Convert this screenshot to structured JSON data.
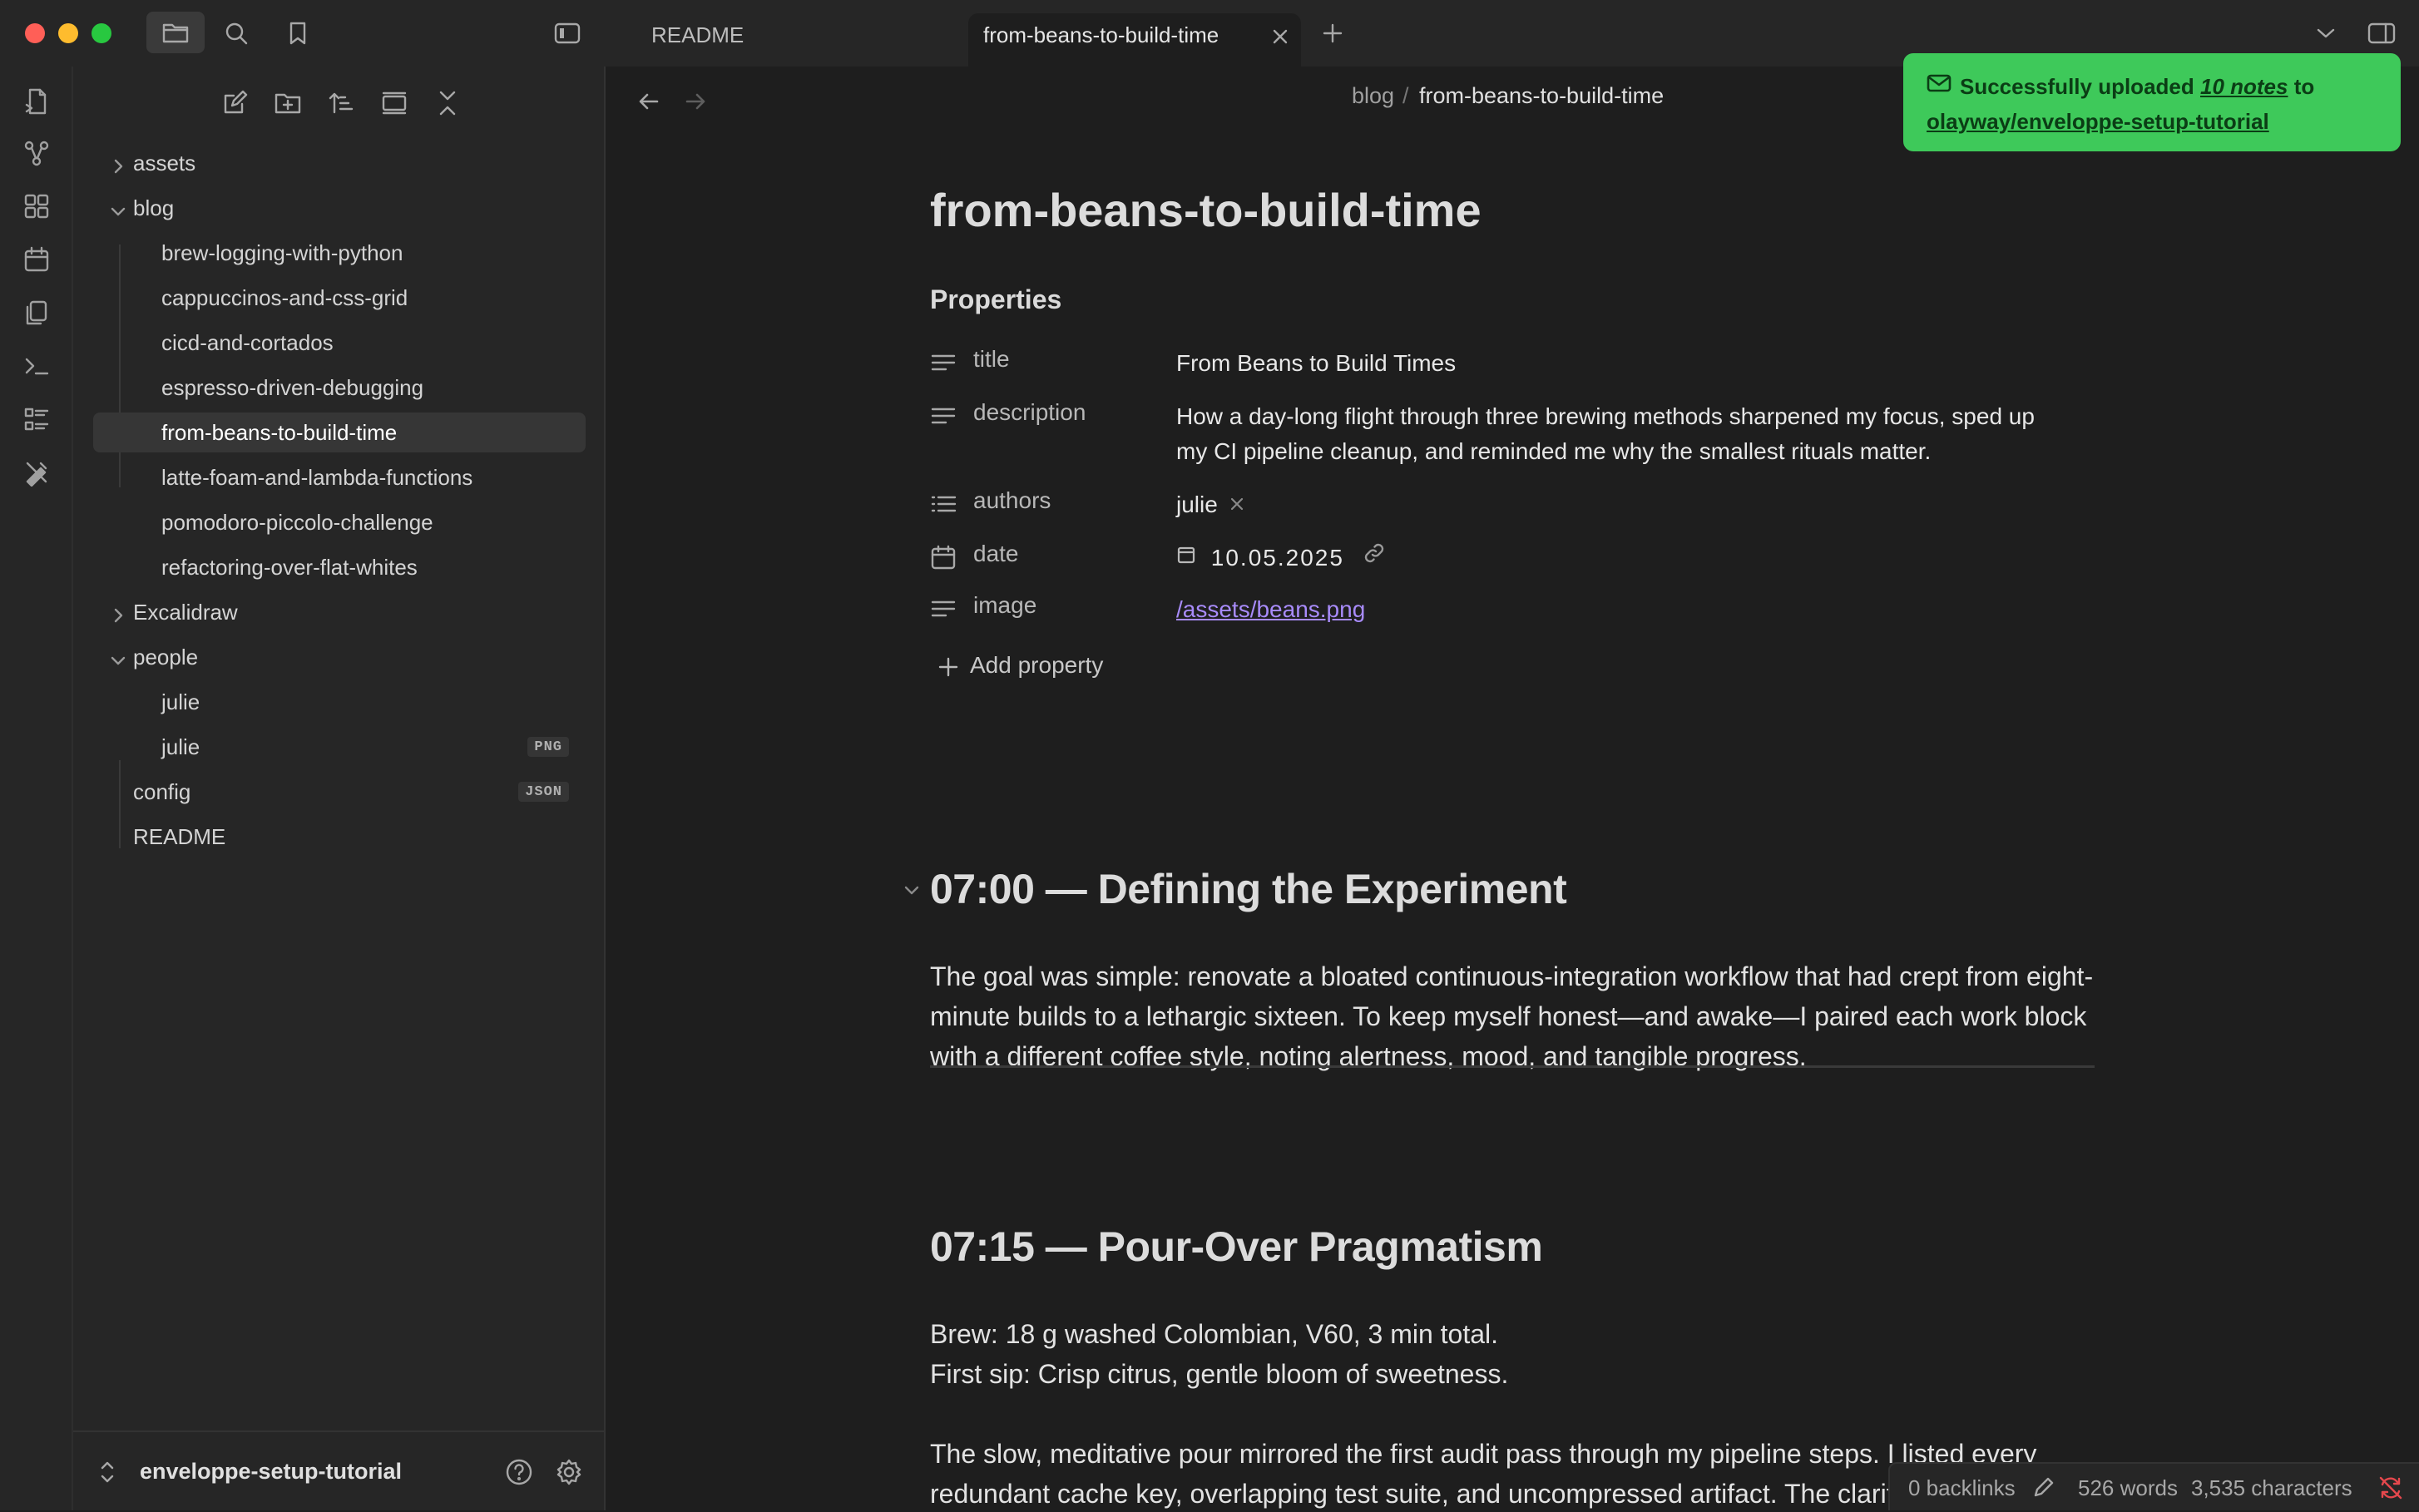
{
  "window": {
    "traffic_lights": {
      "close": "#ff5f57",
      "minimize": "#febc2e",
      "maximize": "#28c840"
    }
  },
  "tabs": [
    {
      "label": "README",
      "active": false
    },
    {
      "label": "from-beans-to-build-time",
      "active": true
    }
  ],
  "icons": {
    "toolbar": [
      "folder-icon",
      "search-icon",
      "bookmark-icon",
      "sidebar-toggle-icon",
      "new-tab-icon",
      "tab-list-chevron-icon",
      "right-sidebar-icon"
    ],
    "ribbon": [
      "open-quick-switcher-icon",
      "graph-view-icon",
      "canvas-icon",
      "daily-note-calendar-icon",
      "templates-icon",
      "command-palette-icon",
      "kanban-icon",
      "excalidraw-icon"
    ],
    "sidebar_tools": [
      "new-note-icon",
      "new-folder-icon",
      "sort-icon",
      "collapse-view-icon",
      "collapse-all-icon"
    ]
  },
  "sidebar": {
    "tree": [
      {
        "label": "assets",
        "type": "folder",
        "expanded": false
      },
      {
        "label": "blog",
        "type": "folder",
        "expanded": true
      },
      {
        "label": "brew-logging-with-python",
        "type": "file"
      },
      {
        "label": "cappuccinos-and-css-grid",
        "type": "file"
      },
      {
        "label": "cicd-and-cortados",
        "type": "file"
      },
      {
        "label": "espresso-driven-debugging",
        "type": "file"
      },
      {
        "label": "from-beans-to-build-time",
        "type": "file",
        "active": true
      },
      {
        "label": "latte-foam-and-lambda-functions",
        "type": "file"
      },
      {
        "label": "pomodoro-piccolo-challenge",
        "type": "file"
      },
      {
        "label": "refactoring-over-flat-whites",
        "type": "file"
      },
      {
        "label": "Excalidraw",
        "type": "folder",
        "expanded": false
      },
      {
        "label": "people",
        "type": "folder",
        "expanded": true
      },
      {
        "label": "julie",
        "type": "file"
      },
      {
        "label": "julie",
        "type": "file",
        "badge": "PNG"
      },
      {
        "label": "config",
        "type": "file",
        "badge": "JSON"
      },
      {
        "label": "README",
        "type": "file"
      }
    ],
    "vault_name": "enveloppe-setup-tutorial"
  },
  "main": {
    "breadcrumb": {
      "folder": "blog",
      "separator": "/",
      "note": "from-beans-to-build-time"
    },
    "title": "from-beans-to-build-time",
    "properties_heading": "Properties",
    "properties": [
      {
        "icon": "text-lines-icon",
        "key": "title",
        "value": "From Beans to Build Times"
      },
      {
        "icon": "text-lines-icon",
        "key": "description",
        "value": "How a day-long flight through three brewing methods sharpened my focus, sped up my CI pipeline cleanup, and reminded me why the smallest rituals matter."
      },
      {
        "icon": "list-icon",
        "key": "authors",
        "value": "julie"
      },
      {
        "icon": "calendar-icon",
        "key": "date",
        "value": "10.05.2025"
      },
      {
        "icon": "text-lines-icon",
        "key": "image",
        "value": "/assets/beans.png"
      }
    ],
    "add_property": "Add property",
    "sections": [
      {
        "heading": "07:00 — Defining the Experiment",
        "paragraphs": [
          "The goal was simple: renovate a bloated continuous-integration workflow that had crept from eight-minute builds to a lethargic sixteen. To keep myself honest—and awake—I paired each work block with a different coffee style, noting alertness, mood, and tangible progress."
        ]
      },
      {
        "heading": "07:15 — Pour-Over Pragmatism",
        "paragraphs": [
          "Brew: 18 g washed Colombian, V60, 3 min total.",
          "First sip: Crisp citrus, gentle bloom of sweetness.",
          "The slow, meditative pour mirrored the first audit pass through my pipeline steps. I listed every redundant cache key, overlapping test suite, and uncompressed artifact. The clarity of the cup matched the clarity of purpose: identify, don't optimize yet. Energy level felt focused but not jittery—perfect for wide-lens thinking."
        ]
      }
    ]
  },
  "toast": {
    "prefix": "Successfully uploaded ",
    "count": "10 notes",
    "middle": " to",
    "repo": "olayway/enveloppe-setup-tutorial",
    "color": "#3ec95a"
  },
  "status_bar": {
    "backlinks": "0 backlinks",
    "words": "526 words",
    "characters": "3,535 characters"
  }
}
